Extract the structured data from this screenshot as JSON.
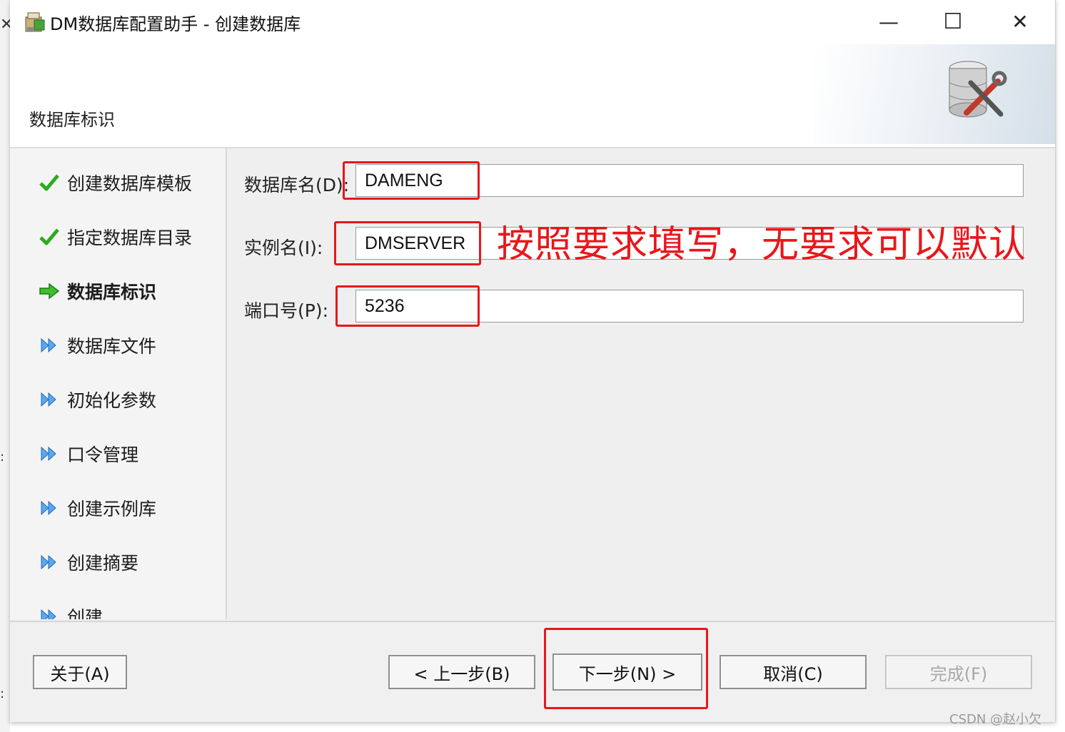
{
  "window": {
    "title": "DM数据库配置助手 - 创建数据库",
    "minimize_glyph": "—",
    "maximize_glyph": "☐",
    "close_glyph": "✕"
  },
  "header": {
    "title": "数据库标识",
    "icon": "database-tools-icon"
  },
  "steps": [
    {
      "label": "创建数据库模板",
      "state": "done",
      "icon": "check-icon"
    },
    {
      "label": "指定数据库目录",
      "state": "done",
      "icon": "check-icon"
    },
    {
      "label": "数据库标识",
      "state": "current",
      "icon": "arrow-right-icon"
    },
    {
      "label": "数据库文件",
      "state": "pending",
      "icon": "double-arrow-icon"
    },
    {
      "label": "初始化参数",
      "state": "pending",
      "icon": "double-arrow-icon"
    },
    {
      "label": "口令管理",
      "state": "pending",
      "icon": "double-arrow-icon"
    },
    {
      "label": "创建示例库",
      "state": "pending",
      "icon": "double-arrow-icon"
    },
    {
      "label": "创建摘要",
      "state": "pending",
      "icon": "double-arrow-icon"
    },
    {
      "label": "创建",
      "state": "pending",
      "icon": "double-arrow-icon"
    }
  ],
  "form": {
    "db_name_label": "数据库名(D):",
    "db_name_value": "DAMENG",
    "instance_label": "实例名(I):",
    "instance_value": "DMSERVER",
    "port_label": "端口号(P):",
    "port_value": "5236"
  },
  "annotation": "按照要求填写，无要求可以默认",
  "buttons": {
    "about": "关于(A)",
    "prev": "< 上一步(B)",
    "next": "下一步(N) >",
    "cancel": "取消(C)",
    "finish": "完成(F)"
  },
  "watermark": "CSDN @赵小欠",
  "colors": {
    "annotation_red": "#e8171b",
    "check_green": "#2eaa1f",
    "arrow_blue": "#3a8fe0"
  }
}
